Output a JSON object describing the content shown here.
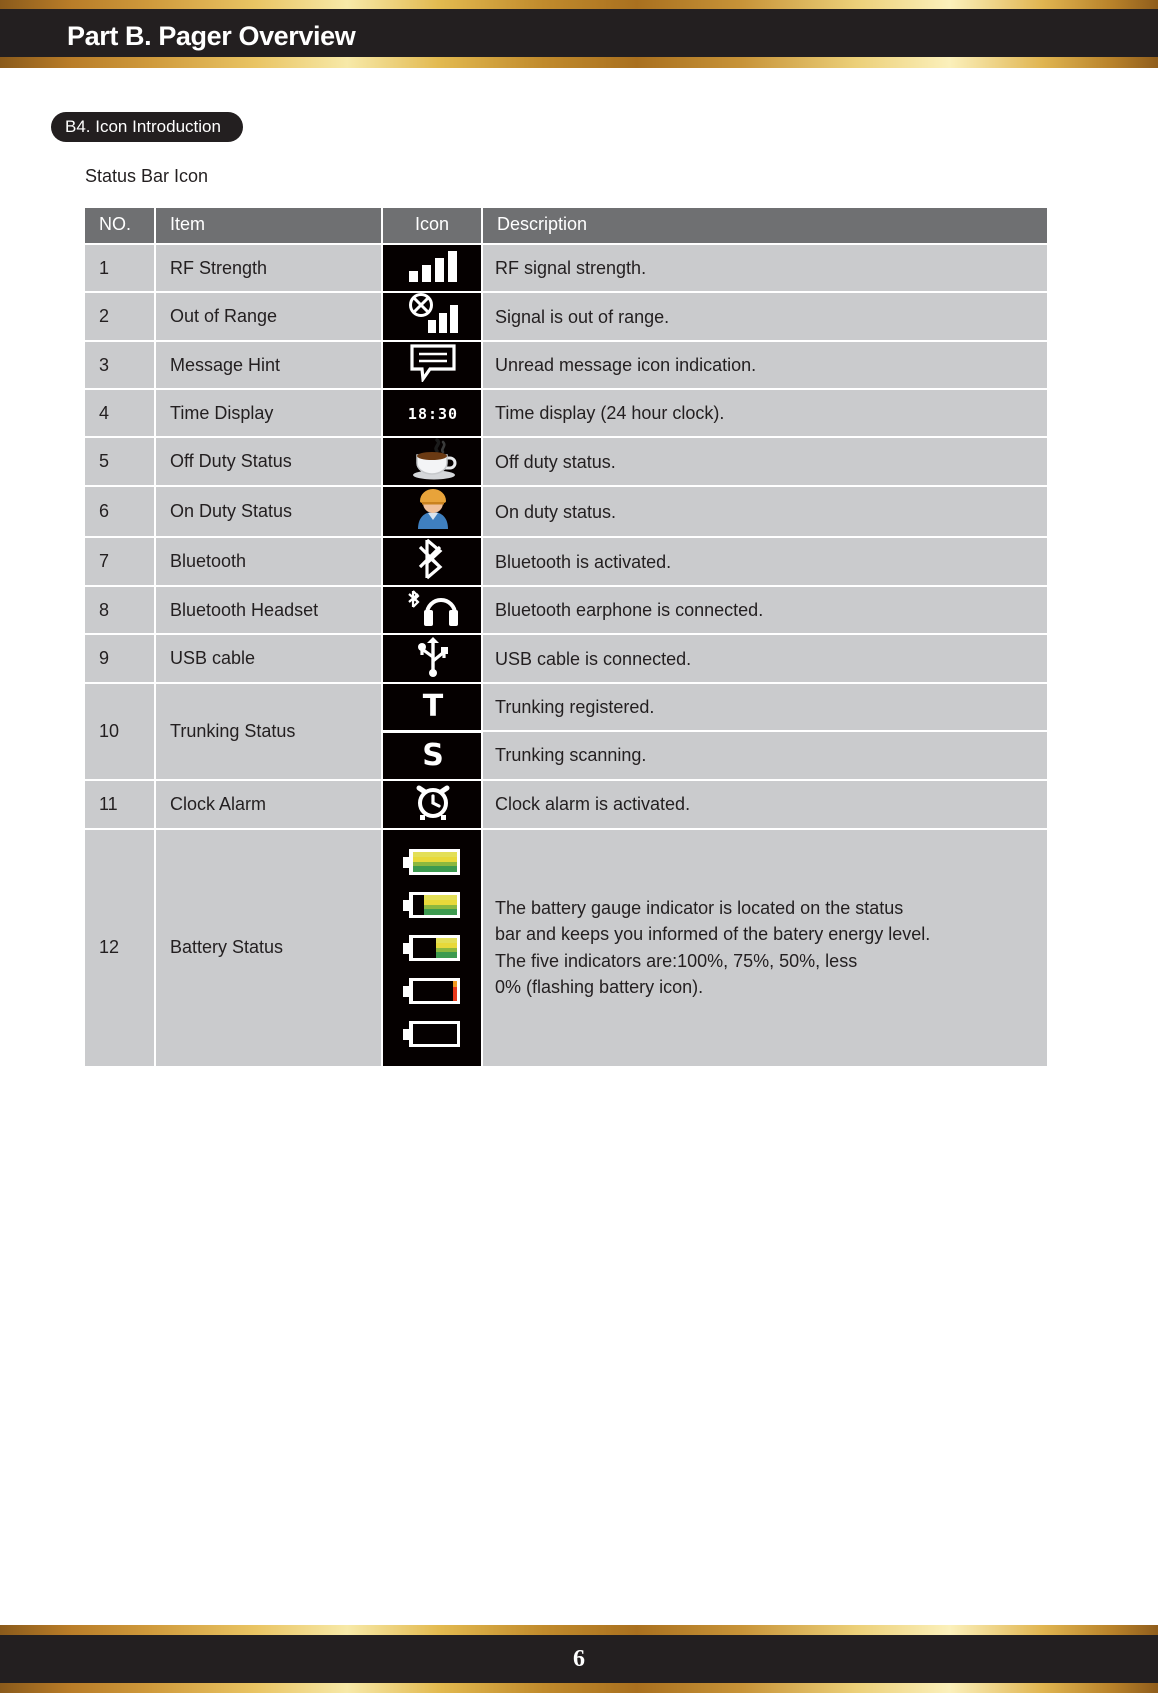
{
  "header": {
    "title": "Part B. Pager Overview"
  },
  "footer": {
    "page_number": "6"
  },
  "section": {
    "pill_label": "B4. Icon Introduction",
    "subtitle": "Status Bar Icon"
  },
  "table": {
    "columns": [
      "NO.",
      "Item",
      "Icon",
      "Description"
    ],
    "rows": [
      {
        "no": "1",
        "item": "RF Strength",
        "icon": "signal-bars-icon",
        "description": "RF signal strength."
      },
      {
        "no": "2",
        "item": "Out of Range",
        "icon": "signal-out-of-range-icon",
        "description": "Signal is out of range."
      },
      {
        "no": "3",
        "item": "Message Hint",
        "icon": "message-bubble-icon",
        "description": "Unread message icon indication."
      },
      {
        "no": "4",
        "item": "Time Display",
        "icon": "clock-time-text-icon",
        "icon_text": "18:30",
        "description": "Time display (24 hour clock)."
      },
      {
        "no": "5",
        "item": "Off Duty Status",
        "icon": "coffee-cup-icon",
        "description": "Off duty status."
      },
      {
        "no": "6",
        "item": "On Duty Status",
        "icon": "worker-person-icon",
        "description": "On duty status."
      },
      {
        "no": "7",
        "item": "Bluetooth",
        "icon": "bluetooth-icon",
        "description": "Bluetooth is activated."
      },
      {
        "no": "8",
        "item": "Bluetooth Headset",
        "icon": "bluetooth-headset-icon",
        "description": "Bluetooth earphone is connected."
      },
      {
        "no": "9",
        "item": "USB cable",
        "icon": "usb-icon",
        "description": "USB cable is connected."
      },
      {
        "no": "10",
        "item": "Trunking Status",
        "icon": "letter-t-icon",
        "icon_text": "T",
        "description": "Trunking registered."
      },
      {
        "no": "",
        "item": "",
        "icon": "letter-s-icon",
        "icon_text": "S",
        "description": "Trunking scanning."
      },
      {
        "no": "11",
        "item": "Clock Alarm",
        "icon": "alarm-clock-icon",
        "description": "Clock alarm is activated."
      },
      {
        "no": "12",
        "item": "Battery Status",
        "icon": "battery-levels-icon",
        "description": "The battery gauge indicator is located on the status\nbar and keeps you informed of the batery energy level.\nThe five indicators are:100%, 75%, 50%, less\n0% (flashing battery icon)."
      }
    ]
  },
  "colors": {
    "gold_accent": "#e2b94f",
    "header_dark": "#231f20",
    "table_header_gray": "#6f7072",
    "table_cell_gray": "#cacbcd",
    "icon_cell_black": "#050000",
    "battery_green": "#3d9a4f",
    "battery_yellow": "#e8d93a",
    "battery_low_red": "#e8381a"
  }
}
